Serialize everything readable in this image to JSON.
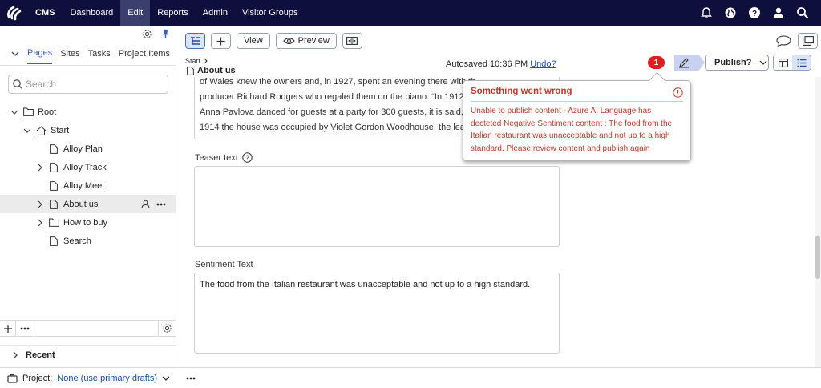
{
  "colors": {
    "topbar_bg": "#0e0f3d",
    "accent": "#3b5fb0",
    "error": "#e02020",
    "error_text": "#c0392b"
  },
  "topbar": {
    "logo_icon": "optimizely-logo-icon",
    "nav": [
      "CMS",
      "Dashboard",
      "Edit",
      "Reports",
      "Admin",
      "Visitor Groups"
    ],
    "active": "Edit",
    "right_icons": [
      "bell-icon",
      "globe-icon",
      "help-icon",
      "user-icon",
      "search-icon"
    ]
  },
  "leftpane": {
    "toolbar_icons": [
      "gear-icon",
      "pin-icon"
    ],
    "tabs": [
      "Pages",
      "Sites",
      "Tasks",
      "Project Items"
    ],
    "active_tab": "Pages",
    "search_placeholder": "Search",
    "tree": [
      {
        "label": "Root",
        "level": 0,
        "expanded": true,
        "has_children": true,
        "icon": "folder-icon"
      },
      {
        "label": "Start",
        "level": 1,
        "expanded": true,
        "has_children": true,
        "icon": "home-icon"
      },
      {
        "label": "Alloy Plan",
        "level": 2,
        "has_children": false,
        "icon": "page-icon"
      },
      {
        "label": "Alloy Track",
        "level": 2,
        "has_children": true,
        "icon": "page-icon"
      },
      {
        "label": "Alloy Meet",
        "level": 2,
        "has_children": false,
        "icon": "page-icon"
      },
      {
        "label": "About us",
        "level": 2,
        "has_children": true,
        "icon": "page-icon",
        "selected": true
      },
      {
        "label": "How to buy",
        "level": 2,
        "has_children": true,
        "icon": "folder-icon"
      },
      {
        "label": "Search",
        "level": 2,
        "has_children": false,
        "icon": "page-icon"
      }
    ],
    "recent_label": "Recent"
  },
  "footer": {
    "project_label": "Project:",
    "project_value": "None (use primary drafts)"
  },
  "toolbar": {
    "view_label": "View",
    "preview_label": "Preview"
  },
  "status": {
    "breadcrumb": "Start",
    "page_title": "About us",
    "autosaved": "Autosaved 10:36 PM",
    "undo": "Undo?",
    "error_count": "1",
    "publish_label": "Publish?"
  },
  "content": {
    "prev_text_lines": [
      "of Wales knew the owners and, in 1927, spent an evening there with th",
      "producer Richard Rodgers who regaled them on the piano. “In 1912 th",
      "Anna Pavlova danced for guests at a party for 300 guests, it is said,”",
      "1914 the house was occupied by Violet Gordon Woodhouse, the lead"
    ],
    "teaser_label": "Teaser text",
    "teaser_value": "",
    "sentiment_label": "Sentiment Text",
    "sentiment_value": "The food from the Italian restaurant was unacceptable and not up to a high standard."
  },
  "popup": {
    "title": "Something went wrong",
    "body": "Unable to publish content - Azure AI Language has decteted Negative Sentiment content : The food from the Italian restaurant was unacceptable and not up to a high standard. Please review content and publish again"
  }
}
